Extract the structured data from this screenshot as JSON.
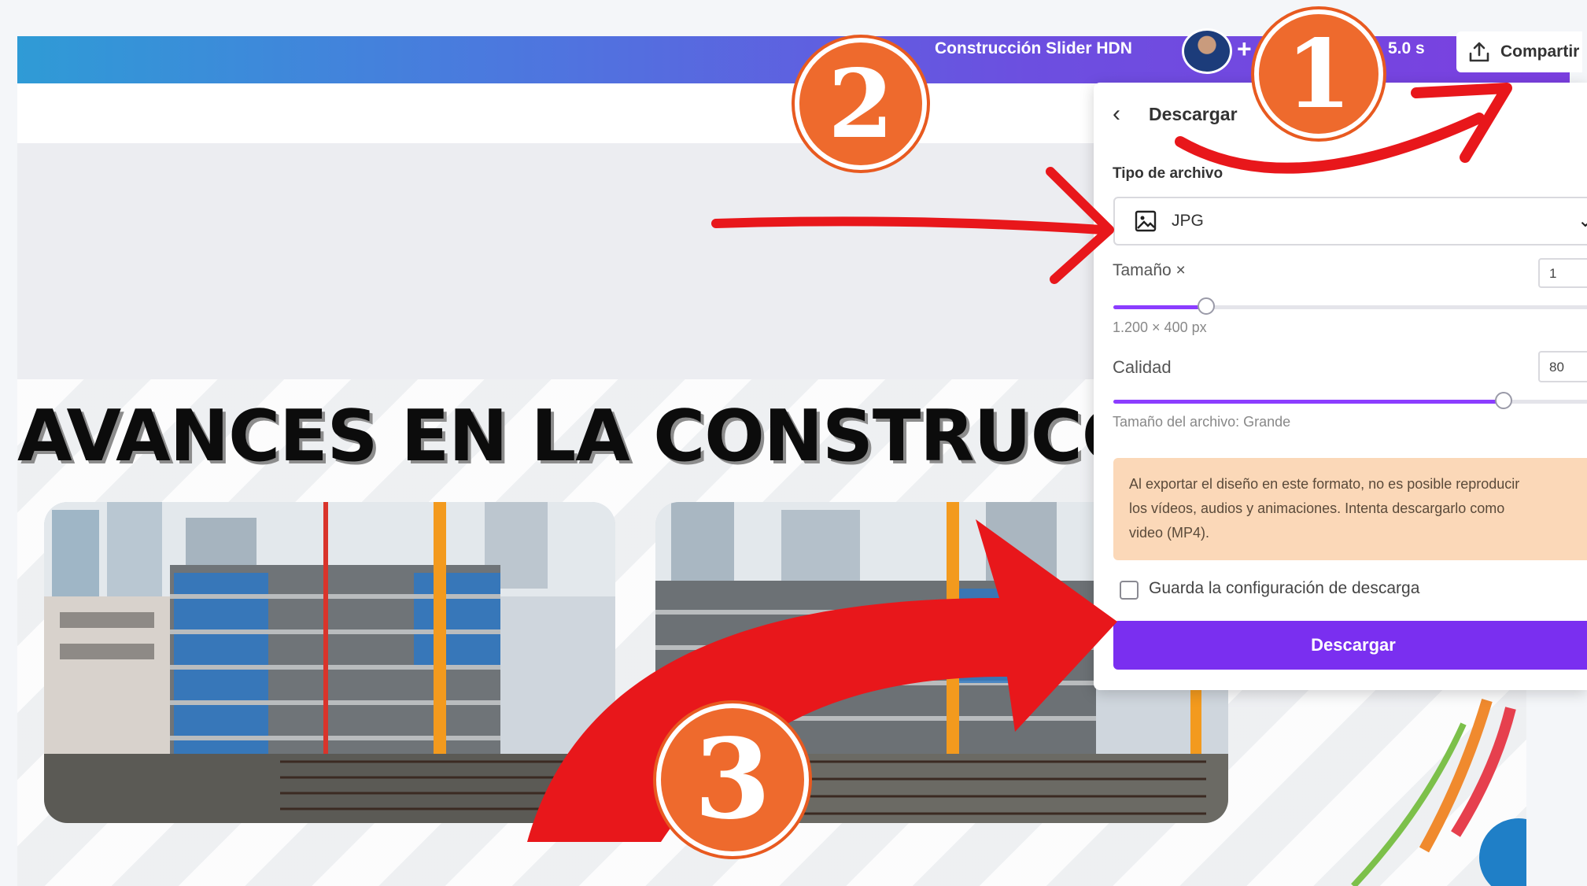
{
  "topbar": {
    "design_title": "Construcción Slider HDN",
    "duration": "5.0 s",
    "share_label": "Compartir"
  },
  "slide": {
    "title": "AVANCES EN LA CONSTRUCCIÓN"
  },
  "download_panel": {
    "title": "Descargar",
    "file_type_label": "Tipo de archivo",
    "file_type_value": "JPG",
    "size_label": "Tamaño ×",
    "size_value": "1",
    "size_fraction": 0.19,
    "dimensions": "1.200 × 400 px",
    "quality_label": "Calidad",
    "quality_value": "80",
    "quality_fraction": 0.8,
    "file_size": "Tamaño del archivo: Grande",
    "warning_lines": [
      "Al exportar el diseño en este formato, no es posible reproducir",
      "los vídeos, audios y animaciones. Intenta descargarlo como",
      "video (MP4)."
    ],
    "save_settings_label": "Guarda la configuración de descarga",
    "download_button": "Descargar"
  },
  "annotations": {
    "badge_1": "1",
    "badge_2": "2",
    "badge_3": "3"
  },
  "colors": {
    "accent": "#8b3dff",
    "button": "#7a2ff0",
    "annotation_red": "#e8171b",
    "badge_orange": "#ee6a2d"
  }
}
